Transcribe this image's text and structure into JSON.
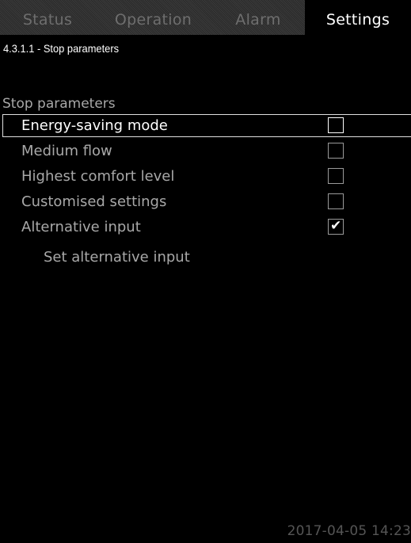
{
  "tabs": {
    "status": "Status",
    "operation": "Operation",
    "alarm": "Alarm",
    "settings": "Settings",
    "active": "settings"
  },
  "breadcrumb": "4.3.1.1 - Stop parameters",
  "section_title": "Stop parameters",
  "options": [
    {
      "label": "Energy-saving mode",
      "checked": false,
      "selected": true
    },
    {
      "label": "Medium flow",
      "checked": false,
      "selected": false
    },
    {
      "label": "Highest comfort level",
      "checked": false,
      "selected": false
    },
    {
      "label": "Customised settings",
      "checked": false,
      "selected": false
    },
    {
      "label": "Alternative input",
      "checked": true,
      "selected": false
    }
  ],
  "sub_item": "Set alternative input",
  "timestamp": "2017-04-05 14:23",
  "colors": {
    "background": "#000000",
    "text_dim": "#a8a8a8",
    "text_bright": "#ffffff",
    "tab_inactive": "#6e6e6e"
  }
}
